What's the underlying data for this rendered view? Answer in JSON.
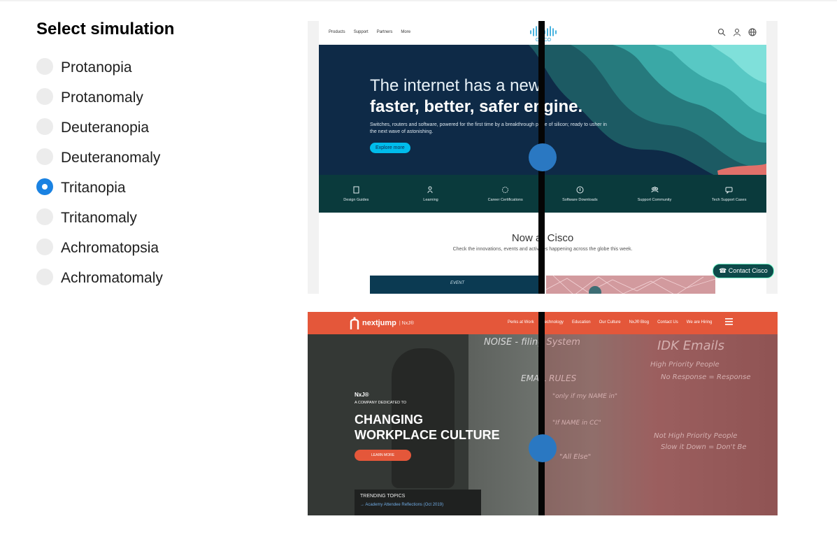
{
  "panel": {
    "title": "Select simulation",
    "options": [
      {
        "label": "Protanopia",
        "selected": false
      },
      {
        "label": "Protanomaly",
        "selected": false
      },
      {
        "label": "Deuteranopia",
        "selected": false
      },
      {
        "label": "Deuteranomaly",
        "selected": false
      },
      {
        "label": "Tritanopia",
        "selected": true
      },
      {
        "label": "Tritanomaly",
        "selected": false
      },
      {
        "label": "Achromatopsia",
        "selected": false
      },
      {
        "label": "Achromatomaly",
        "selected": false
      }
    ]
  },
  "cisco": {
    "nav_links": [
      "Products",
      "Support",
      "Partners",
      "More"
    ],
    "logo_text": "CISCO",
    "hero_line1": "The internet has a new",
    "hero_line2": "faster, better, safer engine.",
    "hero_sub": "Switches, routers and software, powered for the first time by a breakthrough piece of silicon; ready to usher in the next wave of astonishing.",
    "hero_button": "Explore more",
    "icon_items": [
      "Design Guides",
      "Learning",
      "Career Certifications",
      "Software Downloads",
      "Support Community",
      "Tech Support Cases"
    ],
    "now_title": "Now at Cisco",
    "now_sub": "Check the innovations, events and activities happening across the globe this week.",
    "event_label": "EVENT",
    "contact": "Contact Cisco"
  },
  "nxj": {
    "logo": "nextjump",
    "logo_suffix": "NxJ®",
    "nav_links": [
      "Perks at Work",
      "Technology",
      "Education",
      "Our Culture",
      "NxJ® Blog",
      "Contact Us",
      "We are Hiring"
    ],
    "kicker": "NxJ®",
    "sub": "A COMPANY DEDICATED TO",
    "title_line1": "CHANGING",
    "title_line2": "WORKPLACE CULTURE",
    "button": "LEARN MORE",
    "trending_title": "TRENDING TOPICS",
    "trending_item": "Academy Attendee Reflections (Oct 2019)"
  },
  "colors": {
    "accent": "#1a82e2",
    "handle": "#2a78c2",
    "divider": "#050505"
  }
}
